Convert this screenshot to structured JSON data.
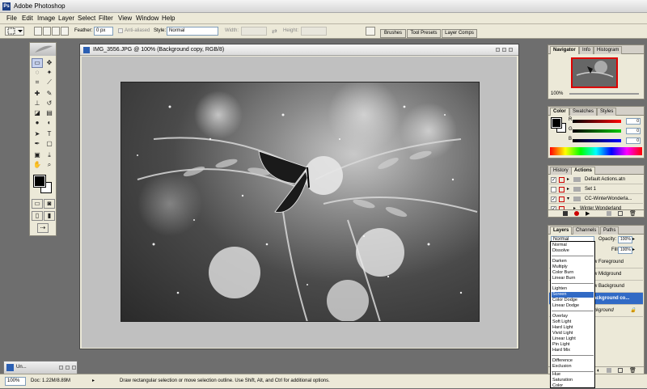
{
  "app": {
    "title": "Adobe Photoshop"
  },
  "menu": [
    "File",
    "Edit",
    "Image",
    "Layer",
    "Select",
    "Filter",
    "View",
    "Window",
    "Help"
  ],
  "options": {
    "feather_label": "Feather:",
    "feather_value": "0 px",
    "antialiased_label": "Anti-aliased",
    "style_label": "Style:",
    "style_value": "Normal",
    "width_label": "Width:",
    "height_label": "Height:",
    "palette_well": [
      "Brushes",
      "Tool Presets",
      "Layer Comps"
    ]
  },
  "document": {
    "title": "IMG_3556.JPG @ 100% (Background copy, RGB/8)"
  },
  "navigator": {
    "tabs": [
      "Navigator",
      "Info",
      "Histogram"
    ],
    "zoom": "100%"
  },
  "color_panel": {
    "tabs": [
      "Color",
      "Swatches",
      "Styles"
    ],
    "channels": [
      {
        "label": "R",
        "value": "0",
        "color": "#ff0000"
      },
      {
        "label": "G",
        "value": "0",
        "color": "#00cc00"
      },
      {
        "label": "B",
        "value": "0",
        "color": "#0000ff"
      }
    ]
  },
  "actions_panel": {
    "tabs": [
      "History",
      "Actions"
    ],
    "items": [
      "Default Actions.atn",
      "Set 1",
      "CC-WinterWonderla...",
      "Winter Wonderland"
    ]
  },
  "layers_panel": {
    "tabs": [
      "Layers",
      "Channels",
      "Paths"
    ],
    "blend_mode": "Normal",
    "opacity_label": "Opacity:",
    "opacity_value": "100%",
    "fill_label": "Fill:",
    "fill_value": "100%",
    "layers": [
      "w Foreground",
      "w Midground",
      "w Background",
      "ackground co...",
      "ckground"
    ]
  },
  "blend_modes": [
    [
      "Normal",
      "Dissolve"
    ],
    [
      "Darken",
      "Multiply",
      "Color Burn",
      "Linear Burn"
    ],
    [
      "Lighten",
      "Screen",
      "Color Dodge",
      "Linear Dodge"
    ],
    [
      "Overlay",
      "Soft Light",
      "Hard Light",
      "Vivid Light",
      "Linear Light",
      "Pin Light",
      "Hard Mix"
    ],
    [
      "Difference",
      "Exclusion"
    ],
    [
      "Hue",
      "Saturation",
      "Color"
    ]
  ],
  "blend_highlight": "Screen",
  "minimized_window": {
    "title": "Un..."
  },
  "status": {
    "zoom": "100%",
    "doc": "Doc: 1.22M/8.89M",
    "hint": "Draw rectangular selection or move selection outline.  Use Shift, Alt, and Ctrl for additional options."
  },
  "colors": {
    "selection": "#316ac5",
    "foreground": "#000000",
    "background": "#ffffff"
  }
}
